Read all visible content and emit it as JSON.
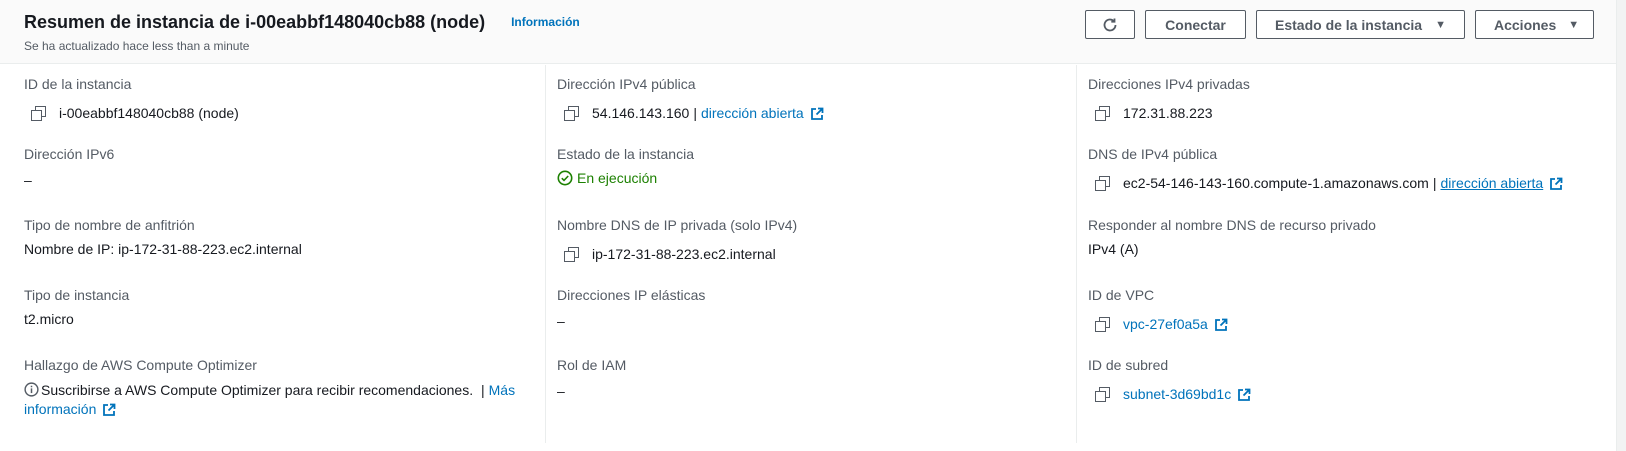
{
  "header": {
    "title": "Resumen de instancia de i-00eabbf148040cb88 (node)",
    "info_link": "Información",
    "subtitle": "Se ha actualizado hace less than a minute",
    "buttons": {
      "connect": "Conectar",
      "instance_state": "Estado de la instancia",
      "actions": "Acciones"
    }
  },
  "fields": {
    "instance_id": {
      "label": "ID de la instancia",
      "value": "i-00eabbf148040cb88 (node)"
    },
    "public_ipv4": {
      "label": "Dirección IPv4 pública",
      "value": "54.146.143.160",
      "separator": "|",
      "link": "dirección abierta"
    },
    "private_ipv4": {
      "label": "Direcciones IPv4 privadas",
      "value": "172.31.88.223"
    },
    "ipv6": {
      "label": "Dirección IPv6",
      "value": "–"
    },
    "instance_state": {
      "label": "Estado de la instancia",
      "value": "En ejecución"
    },
    "public_dns": {
      "label": "DNS de IPv4 pública",
      "value": "ec2-54-146-143-160.compute-1.amazonaws.com",
      "separator": "|",
      "link": "dirección abierta"
    },
    "hostname_type": {
      "label": "Tipo de nombre de anfitrión",
      "value": "Nombre de IP: ip-172-31-88-223.ec2.internal"
    },
    "private_dns": {
      "label": "Nombre DNS de IP privada (solo IPv4)",
      "value": "ip-172-31-88-223.ec2.internal"
    },
    "resource_dns": {
      "label": "Responder al nombre DNS de recurso privado",
      "value": "IPv4 (A)"
    },
    "instance_type": {
      "label": "Tipo de instancia",
      "value": "t2.micro"
    },
    "elastic_ip": {
      "label": "Direcciones IP elásticas",
      "value": "–"
    },
    "vpc_id": {
      "label": "ID de VPC",
      "value": "vpc-27ef0a5a"
    },
    "optimizer": {
      "label": "Hallazgo de AWS Compute Optimizer",
      "text": "Suscribirse a AWS Compute Optimizer para recibir recomendaciones.",
      "separator": "|",
      "link_part1": "Más",
      "link_part2": "información"
    },
    "iam_role": {
      "label": "Rol de IAM",
      "value": "–"
    },
    "subnet_id": {
      "label": "ID de subred",
      "value": "subnet-3d69bd1c"
    }
  },
  "colors": {
    "link": "#0073bb",
    "success": "#1d8102",
    "label": "#545b64",
    "text": "#16191f"
  }
}
